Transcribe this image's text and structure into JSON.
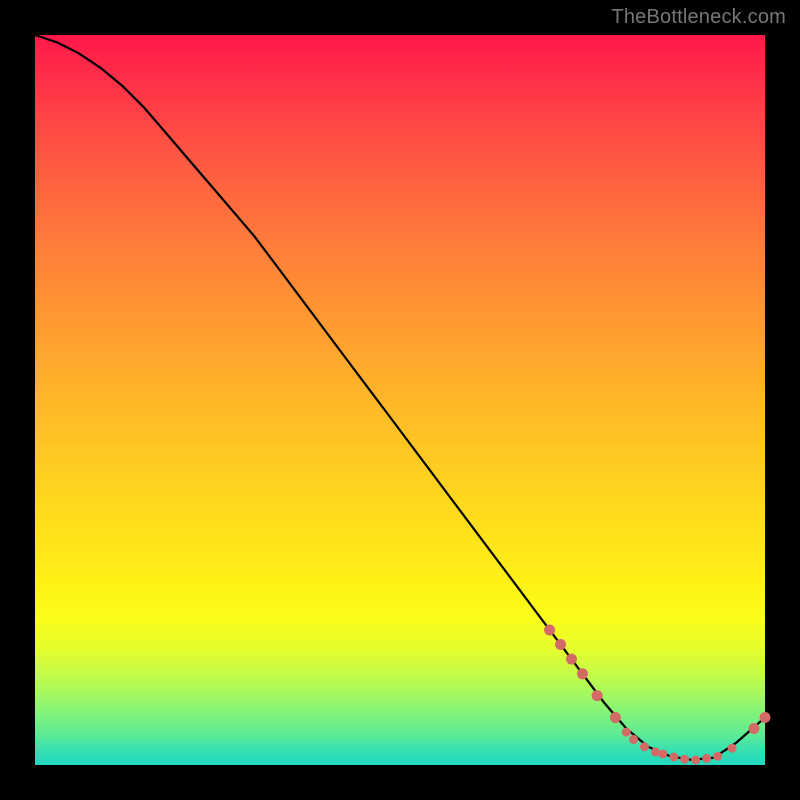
{
  "watermark": "TheBottleneck.com",
  "colors": {
    "background": "#000000",
    "curve": "#000000",
    "dots": "#d46a66",
    "gradient_top": "#ff184a",
    "gradient_bottom": "#20d8c0"
  },
  "chart_data": {
    "type": "line",
    "title": "",
    "xlabel": "",
    "ylabel": "",
    "xlim": [
      0,
      100
    ],
    "ylim": [
      0,
      100
    ],
    "grid": false,
    "legend": false,
    "series": [
      {
        "name": "bottleneck-curve",
        "x": [
          0,
          3,
          6,
          9,
          12,
          15,
          18,
          21,
          24,
          27,
          30,
          33,
          36,
          39,
          42,
          45,
          48,
          51,
          54,
          57,
          60,
          63,
          66,
          69,
          72,
          75,
          78,
          81,
          84,
          87,
          90,
          93,
          96,
          100
        ],
        "y": [
          100,
          99,
          97.5,
          95.5,
          93,
          90,
          86.5,
          83,
          79.5,
          76,
          72.5,
          68.5,
          64.5,
          60.5,
          56.5,
          52.5,
          48.5,
          44.5,
          40.5,
          36.5,
          32.5,
          28.5,
          24.5,
          20.5,
          16.5,
          12.5,
          8.5,
          5,
          2.5,
          1.2,
          0.7,
          1.0,
          3.0,
          6.5
        ]
      }
    ],
    "markers": [
      {
        "x": 70.5,
        "y": 18.5,
        "r": 5.5
      },
      {
        "x": 72.0,
        "y": 16.5,
        "r": 5.5
      },
      {
        "x": 73.5,
        "y": 14.5,
        "r": 5.5
      },
      {
        "x": 75.0,
        "y": 12.5,
        "r": 5.5
      },
      {
        "x": 77.0,
        "y": 9.5,
        "r": 5.5
      },
      {
        "x": 79.5,
        "y": 6.5,
        "r": 5.5
      },
      {
        "x": 81.0,
        "y": 4.5,
        "r": 4.5
      },
      {
        "x": 82.0,
        "y": 3.5,
        "r": 4.5
      },
      {
        "x": 83.5,
        "y": 2.5,
        "r": 4.5
      },
      {
        "x": 85.0,
        "y": 1.8,
        "r": 4.5
      },
      {
        "x": 86.0,
        "y": 1.5,
        "r": 4.5
      },
      {
        "x": 87.5,
        "y": 1.1,
        "r": 4.5
      },
      {
        "x": 89.0,
        "y": 0.8,
        "r": 4.5
      },
      {
        "x": 90.5,
        "y": 0.7,
        "r": 4.5
      },
      {
        "x": 92.0,
        "y": 0.9,
        "r": 4.5
      },
      {
        "x": 93.5,
        "y": 1.2,
        "r": 4.5
      },
      {
        "x": 95.5,
        "y": 2.3,
        "r": 4.5
      },
      {
        "x": 98.5,
        "y": 5.0,
        "r": 5.5
      },
      {
        "x": 100.0,
        "y": 6.5,
        "r": 5.5
      }
    ]
  }
}
